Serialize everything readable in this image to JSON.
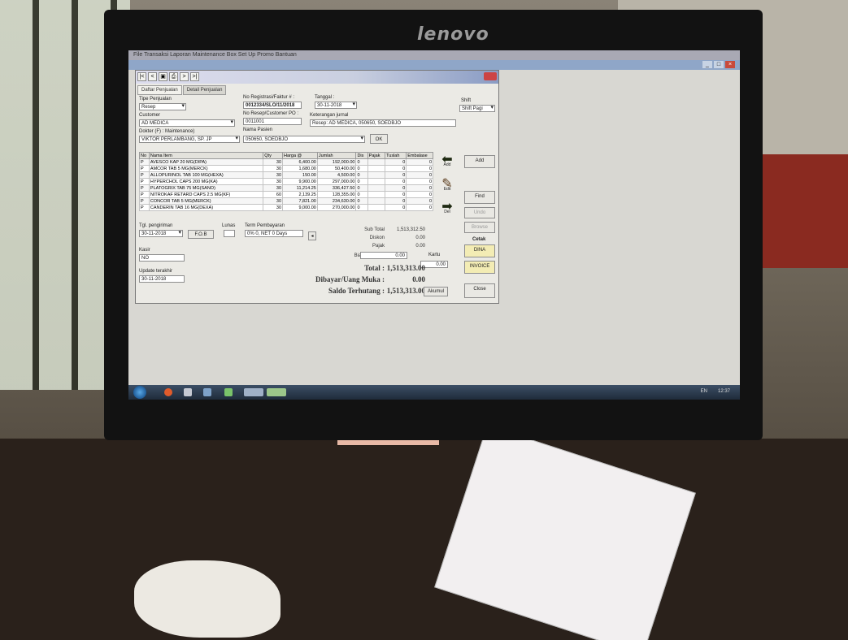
{
  "monitor": {
    "brand": "lenovo"
  },
  "menubar": {
    "text": "File   Transaksi   Laporan   Maintenance Box Set Up   Promo   Bantuan"
  },
  "toolbar": {
    "nav_first": "|<",
    "nav_prev": "<",
    "nav_next": ">",
    "nav_last": ">|"
  },
  "tabs": [
    {
      "label": "Daftar Penjualan"
    },
    {
      "label": "Detail Penjualan"
    }
  ],
  "form": {
    "tipe_label": "Tipe Penjualan",
    "tipe_value": "Resep",
    "customer_label": "Customer",
    "customer_value": "AD MEDICA",
    "dokter_label": "Dokter (F) : Maintenance)",
    "dokter_value": "VIKTOR PERLAMBANG, SP. JP",
    "noreg_label": "No Registrasi/Faktur # :",
    "noreg_value": "0012334/SLO/11/2018",
    "tanggal_label": "Tanggal :",
    "tanggal_value": "30-11-2018",
    "shift_label": "Shift",
    "shift_value": "Shift Pagi",
    "noresep_label": "No Resep/Customer PO :",
    "noresep_value": "0011001",
    "keterangan_label": "Keterangan jurnal",
    "keterangan_value": "Resep: AD MEDICA, 050650, SOEDBJO",
    "pasien_label": "Nama Pasien",
    "pasien_value": "050650, SOEDBJO",
    "ok_label": "OK"
  },
  "grid": {
    "headers": [
      "No",
      "Nama Item",
      "Qty",
      "Harga @",
      "Jumlah",
      "Dis",
      "Pajak",
      "Tuslah",
      "Embalase"
    ],
    "rows": [
      [
        "P",
        "AVESCO KAP 20 MG(DIPA)",
        "30",
        "6,400.00",
        "192,000.00",
        "0",
        "",
        "0",
        "0"
      ],
      [
        "P",
        "AMCOR TAB 5 MG(MERCK)",
        "30",
        "1,680.00",
        "50,400.00",
        "0",
        "",
        "0",
        "0"
      ],
      [
        "P",
        "ALLOPURINOL TAB 100 MG(HEXA)",
        "30",
        "150.00",
        "4,500.00",
        "0",
        "",
        "0",
        "0"
      ],
      [
        "P",
        "HYPERCHOL CAPS 200 MG(KA)",
        "30",
        "9,900.00",
        "297,000.00",
        "0",
        "",
        "0",
        "0"
      ],
      [
        "P",
        "PLATOGRIX TAB 75 MG(SANO)",
        "30",
        "11,214.25",
        "336,427.50",
        "0",
        "",
        "0",
        "0"
      ],
      [
        "P",
        "NITROKAF RETARD CAPS 2.5 MG(KF)",
        "60",
        "2,139.25",
        "128,355.00",
        "0",
        "",
        "0",
        "0"
      ],
      [
        "P",
        "CONCOR TAB 5 MG(MERCK)",
        "30",
        "7,821.00",
        "234,630.00",
        "0",
        "",
        "0",
        "0"
      ],
      [
        "P",
        "CANDERIN TAB 16 MG(DEXA)",
        "30",
        "9,000.00",
        "270,000.00",
        "0",
        "",
        "0",
        "0"
      ]
    ]
  },
  "side_actions": {
    "add": "Add",
    "edit": "Edit",
    "del": "Del"
  },
  "right_buttons": {
    "add": "Add",
    "find": "Find",
    "undo": "Undo",
    "browse": "Browse",
    "cetak": "Cetak",
    "dina": "DINA",
    "invoice": "INVOICE",
    "close": "Close"
  },
  "bottom": {
    "tgl_label": "Tgl. pengiriman",
    "tgl_value": "30-11-2018",
    "lunas_label": "Lunas",
    "term_label": "Term Pembayaran",
    "term_value": "0% 0, NET 0 Days",
    "kasir_label": "Kasir",
    "kasir_value": "NO",
    "update_label": "Update terakhir",
    "update_value": "30-11-2018",
    "fob_value": "F.O.B",
    "kartu_label": "Kartu",
    "kartu_value": "0.00",
    "akum_label": "Akumul"
  },
  "totals": {
    "subtotal_label": "Sub Total",
    "subtotal_value": "1,513,312.50",
    "diskon_label": "Diskon",
    "diskon_value": "0.00",
    "pajak_label": "Pajak",
    "pajak_value": "0.00",
    "biaya_label": "Biaya lain-lain",
    "biaya_value": "0.00",
    "total_label": "Total :",
    "total_value": "1,513,313.00",
    "dibayar_label": "Dibayar/Uang Muka :",
    "dibayar_value": "0.00",
    "saldo_label": "Saldo Terhutang :",
    "saldo_value": "1,513,313.00"
  },
  "taskbar": {
    "lang": "EN",
    "clock": "12:37"
  }
}
